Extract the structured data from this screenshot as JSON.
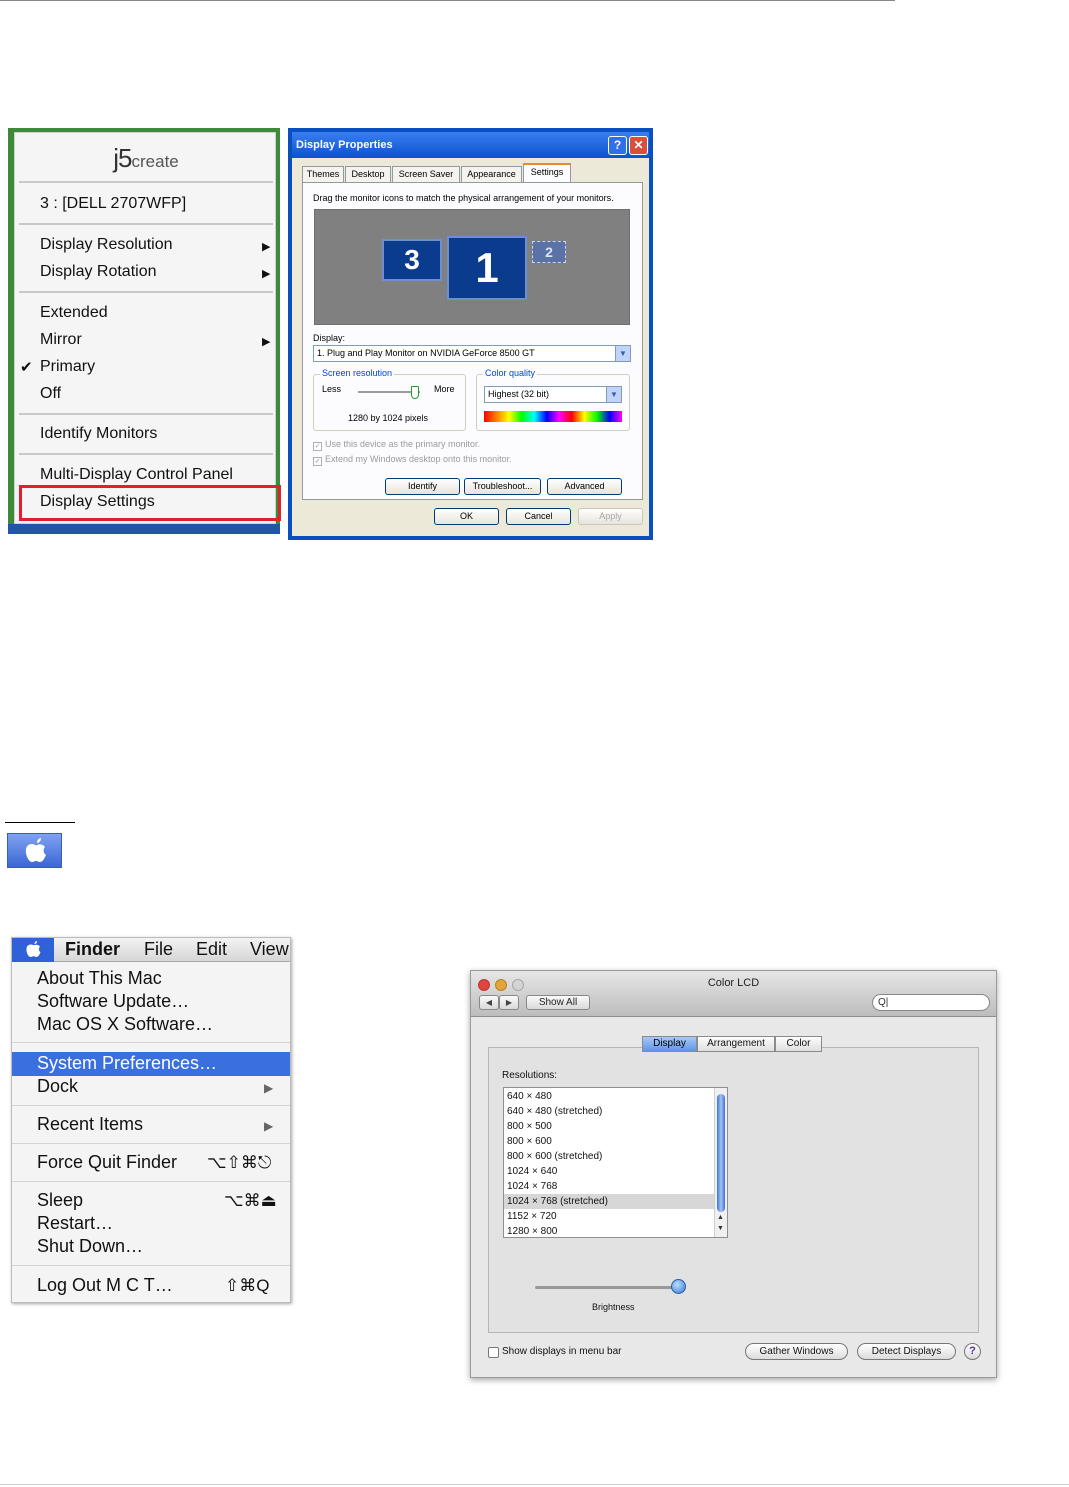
{
  "j5_menu": {
    "logo_main": "j5",
    "logo_small": "create",
    "monitor": "3 : [DELL 2707WFP]",
    "display_resolution": "Display Resolution",
    "display_rotation": "Display Rotation",
    "extended": "Extended",
    "mirror": "Mirror",
    "primary": "Primary",
    "off": "Off",
    "identify_monitors": "Identify Monitors",
    "control_panel": "Multi-Display Control Panel",
    "display_settings": "Display Settings",
    "check_mark": "✔",
    "submenu_arrow": "▶"
  },
  "xp_dialog": {
    "title": "Display Properties",
    "help_btn": "?",
    "close_btn": "✕",
    "tabs": [
      "Themes",
      "Desktop",
      "Screen Saver",
      "Appearance",
      "Settings"
    ],
    "instruction": "Drag the monitor icons to match the physical arrangement of your monitors.",
    "monitors": [
      "3",
      "1",
      "2"
    ],
    "display_label": "Display:",
    "display_value": "1. Plug and Play Monitor on NVIDIA GeForce 8500 GT",
    "screen_resolution_label": "Screen resolution",
    "less": "Less",
    "more": "More",
    "resolution_value": "1280 by 1024 pixels",
    "color_quality_label": "Color quality",
    "color_quality_value": "Highest (32 bit)",
    "primary_check": "Use this device as the primary monitor.",
    "extend_check": "Extend my Windows desktop onto this monitor.",
    "identify_btn": "Identify",
    "troubleshoot_btn": "Troubleshoot...",
    "advanced_btn": "Advanced",
    "ok_btn": "OK",
    "cancel_btn": "Cancel",
    "apply_btn": "Apply",
    "combo_arrow": "▼",
    "check_glyph": "✓"
  },
  "mac_menu": {
    "bar": [
      "Finder",
      "File",
      "Edit",
      "View"
    ],
    "items": {
      "about": "About This Mac",
      "software_update": "Software Update…",
      "mac_os_software": "Mac OS X Software…",
      "system_preferences": "System Preferences…",
      "dock": "Dock",
      "recent_items": "Recent Items",
      "force_quit": "Force Quit Finder",
      "sleep": "Sleep",
      "restart": "Restart…",
      "shut_down": "Shut Down…",
      "log_out": "Log Out M C T…"
    },
    "shortcuts": {
      "force_quit": "⌥⇧⌘⎋",
      "sleep": "⌥⌘⏏",
      "log_out": "⇧⌘Q"
    },
    "submenu_arrow": "▶"
  },
  "color_lcd": {
    "title": "Color LCD",
    "back_btn": "◀",
    "forward_btn": "▶",
    "show_all": "Show All",
    "search_value": "Q|",
    "tabs": [
      "Display",
      "Arrangement",
      "Color"
    ],
    "resolutions_label": "Resolutions:",
    "resolutions": [
      "640 × 480",
      "640 × 480 (stretched)",
      "800 × 500",
      "800 × 600",
      "800 × 600 (stretched)",
      "1024 × 640",
      "1024 × 768",
      "1024 × 768 (stretched)",
      "1152 × 720",
      "1280 × 800"
    ],
    "selected_resolution": "1024 × 768 (stretched)",
    "brightness_label": "Brightness",
    "brightness_level": 0.95,
    "show_in_menu_bar": "Show displays in menu bar",
    "gather_windows": "Gather Windows",
    "detect_displays": "Detect Displays",
    "help": "?",
    "scroll_up": "▲",
    "scroll_down": "▼"
  },
  "colors": {
    "highlight_red": "#e0202a",
    "xp_blue": "#0a4fbf",
    "mac_selection": "#3a6fe0"
  }
}
